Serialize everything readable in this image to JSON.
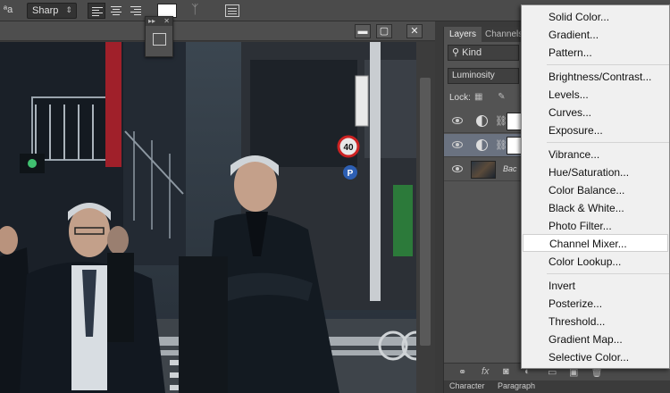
{
  "options_bar": {
    "aa_label": "ªa",
    "antialias": "Sharp",
    "icons": [
      "align-left-icon",
      "align-center-icon",
      "align-right-icon",
      "text-color-swatch",
      "warp-text-icon",
      "character-panel-icon"
    ],
    "text_color": "#ffffff"
  },
  "document": {
    "minimize": "▬",
    "maximize": "▢",
    "close": "✕"
  },
  "mini_panel": {
    "expand": "▸▸",
    "close": "✕"
  },
  "layers_panel": {
    "tabs": [
      "Layers",
      "Channels"
    ],
    "filter_kind": "Kind",
    "blend_mode": "Luminosity",
    "lock_label": "Lock:",
    "layers": [
      {
        "type": "adjustment",
        "selected": false
      },
      {
        "type": "adjustment",
        "selected": true
      },
      {
        "type": "background",
        "name": "Bac"
      }
    ],
    "bottom_icons": [
      "link-icon",
      "fx-icon",
      "mask-icon",
      "adjustment-icon",
      "folder-icon",
      "new-layer-icon",
      "trash-icon"
    ],
    "fx_label": "fx",
    "bottom_tabs": [
      "Character",
      "Paragraph"
    ]
  },
  "adjustment_menu": {
    "hovered": "Channel Mixer...",
    "groups": [
      [
        "Solid Color...",
        "Gradient...",
        "Pattern..."
      ],
      [
        "Brightness/Contrast...",
        "Levels...",
        "Curves...",
        "Exposure..."
      ],
      [
        "Vibrance...",
        "Hue/Saturation...",
        "Color Balance...",
        "Black & White...",
        "Photo Filter...",
        "Channel Mixer...",
        "Color Lookup..."
      ],
      [
        "Invert",
        "Posterize...",
        "Threshold...",
        "Gradient Map...",
        "Selective Color..."
      ]
    ]
  },
  "photo": {
    "sign_text": "40",
    "parking_sign": "P"
  }
}
